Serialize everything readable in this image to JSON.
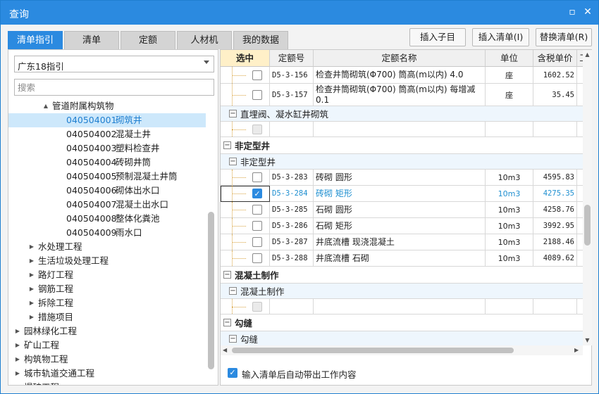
{
  "window": {
    "title": "查询",
    "minimize_glyph": "▫",
    "close_glyph": "✕"
  },
  "tabs": [
    {
      "label": "清单指引",
      "active": true
    },
    {
      "label": "清单",
      "active": false
    },
    {
      "label": "定额",
      "active": false
    },
    {
      "label": "人材机",
      "active": false
    },
    {
      "label": "我的数据",
      "active": false
    }
  ],
  "toolbar": {
    "insert_child_label": "插入子目",
    "insert_list_label": "插入清单(I)",
    "replace_list_label": "替换清单(R)"
  },
  "left": {
    "combo_value": "广东18指引",
    "search_placeholder": "搜索",
    "tree": [
      {
        "level": 2,
        "arrow": "▲",
        "code": "",
        "name": "管道附属构筑物",
        "selected": false
      },
      {
        "level": 3,
        "arrow": "",
        "code": "040504001",
        "name": "砌筑井",
        "selected": true
      },
      {
        "level": 3,
        "arrow": "",
        "code": "040504002",
        "name": "混凝土井",
        "selected": false
      },
      {
        "level": 3,
        "arrow": "",
        "code": "040504003",
        "name": "塑料检查井",
        "selected": false
      },
      {
        "level": 3,
        "arrow": "",
        "code": "040504004",
        "name": "砖砌井筒",
        "selected": false
      },
      {
        "level": 3,
        "arrow": "",
        "code": "040504005",
        "name": "预制混凝土井筒",
        "selected": false
      },
      {
        "level": 3,
        "arrow": "",
        "code": "040504006",
        "name": "砌体出水口",
        "selected": false
      },
      {
        "level": 3,
        "arrow": "",
        "code": "040504007",
        "name": "混凝土出水口",
        "selected": false
      },
      {
        "level": 3,
        "arrow": "",
        "code": "040504008",
        "name": "整体化粪池",
        "selected": false
      },
      {
        "level": 3,
        "arrow": "",
        "code": "040504009",
        "name": "雨水口",
        "selected": false
      },
      {
        "level": 1,
        "arrow": "▶",
        "code": "",
        "name": "水处理工程",
        "selected": false
      },
      {
        "level": 1,
        "arrow": "▶",
        "code": "",
        "name": "生活垃圾处理工程",
        "selected": false
      },
      {
        "level": 1,
        "arrow": "▶",
        "code": "",
        "name": "路灯工程",
        "selected": false
      },
      {
        "level": 1,
        "arrow": "▶",
        "code": "",
        "name": "钢筋工程",
        "selected": false
      },
      {
        "level": 1,
        "arrow": "▶",
        "code": "",
        "name": "拆除工程",
        "selected": false
      },
      {
        "level": 1,
        "arrow": "▶",
        "code": "",
        "name": "措施项目",
        "selected": false
      },
      {
        "level": 0,
        "arrow": "▶",
        "code": "",
        "name": "园林绿化工程",
        "selected": false
      },
      {
        "level": 0,
        "arrow": "▶",
        "code": "",
        "name": "矿山工程",
        "selected": false
      },
      {
        "level": 0,
        "arrow": "▶",
        "code": "",
        "name": "构筑物工程",
        "selected": false
      },
      {
        "level": 0,
        "arrow": "▶",
        "code": "",
        "name": "城市轨道交通工程",
        "selected": false
      },
      {
        "level": 0,
        "arrow": "▶",
        "code": "",
        "name": "爆破工程",
        "selected": false
      }
    ]
  },
  "grid": {
    "headers": [
      "选中",
      "定额号",
      "定额名称",
      "单位",
      "含税单价",
      "工"
    ],
    "rows": [
      {
        "type": "item",
        "checked": false,
        "code": "D5-3-156",
        "name": "检查井筒砌筑(Φ700) 筒高(m以内) 4.0",
        "unit": "座",
        "price": "1602.52",
        "h": 24,
        "highlight": false,
        "disabled": false
      },
      {
        "type": "item",
        "checked": false,
        "code": "D5-3-157",
        "name": "检查井筒砌筑(Φ700) 筒高(m以内) 每增减0.1",
        "unit": "座",
        "price": "35.45",
        "h": 32,
        "highlight": false,
        "disabled": false
      },
      {
        "type": "group2",
        "label": "直埋阀、凝水缸井砌筑",
        "h": 22
      },
      {
        "type": "item",
        "checked": false,
        "code": "",
        "name": "",
        "unit": "",
        "price": "",
        "h": 22,
        "highlight": false,
        "disabled": true
      },
      {
        "type": "group1",
        "label": "非定型井",
        "h": 24
      },
      {
        "type": "group2",
        "label": "非定型井",
        "h": 22
      },
      {
        "type": "item",
        "checked": false,
        "code": "D5-3-283",
        "name": "砖砌 圆形",
        "unit": "10m3",
        "price": "4595.83",
        "h": 23,
        "highlight": false,
        "disabled": false
      },
      {
        "type": "item",
        "checked": true,
        "code": "D5-3-284",
        "name": "砖砌 矩形",
        "unit": "10m3",
        "price": "4275.35",
        "h": 23,
        "highlight": true,
        "disabled": false
      },
      {
        "type": "item",
        "checked": false,
        "code": "D5-3-285",
        "name": "石砌 圆形",
        "unit": "10m3",
        "price": "4258.76",
        "h": 23,
        "highlight": false,
        "disabled": false
      },
      {
        "type": "item",
        "checked": false,
        "code": "D5-3-286",
        "name": "石砌 矩形",
        "unit": "10m3",
        "price": "3992.95",
        "h": 23,
        "highlight": false,
        "disabled": false
      },
      {
        "type": "item",
        "checked": false,
        "code": "D5-3-287",
        "name": "井底流槽 现浇混凝土",
        "unit": "10m3",
        "price": "2188.46",
        "h": 23,
        "highlight": false,
        "disabled": false
      },
      {
        "type": "item",
        "checked": false,
        "code": "D5-3-288",
        "name": "井底流槽 石砌",
        "unit": "10m3",
        "price": "4089.62",
        "h": 23,
        "highlight": false,
        "disabled": false
      },
      {
        "type": "group1",
        "label": "混凝土制作",
        "h": 24
      },
      {
        "type": "group2",
        "label": "混凝土制作",
        "h": 22
      },
      {
        "type": "item",
        "checked": false,
        "code": "",
        "name": "",
        "unit": "",
        "price": "",
        "h": 22,
        "highlight": false,
        "disabled": true
      },
      {
        "type": "group1",
        "label": "勾缝",
        "h": 24
      },
      {
        "type": "group2",
        "label": "勾缝",
        "h": 22
      }
    ]
  },
  "footer": {
    "checkbox_label": "输入清单后自动带出工作内容",
    "checked": true
  }
}
